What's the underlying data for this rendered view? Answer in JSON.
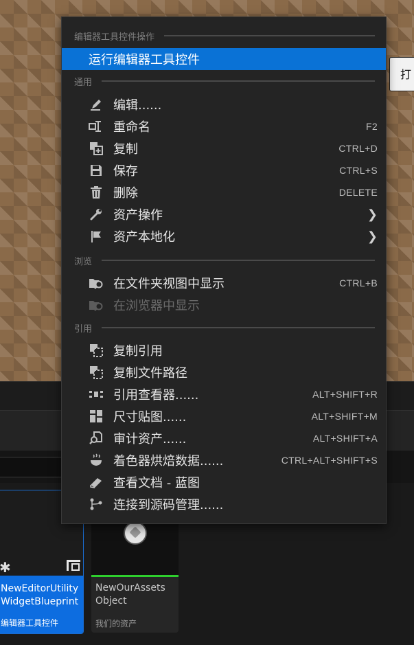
{
  "viewport": {
    "tooltip_text": "打"
  },
  "context_menu": {
    "sections": {
      "editor_tools": "编辑器工具控件操作",
      "common": "通用",
      "browse": "浏览",
      "reference": "引用"
    },
    "items": {
      "run": {
        "label": "运行编辑器工具控件"
      },
      "edit": {
        "label": "编辑......",
        "icon": "pencil-icon"
      },
      "rename": {
        "label": "重命名",
        "shortcut": "F2",
        "icon": "rename-icon"
      },
      "duplicate": {
        "label": "复制",
        "shortcut": "CTRL+D",
        "icon": "duplicate-icon"
      },
      "save": {
        "label": "保存",
        "shortcut": "CTRL+S",
        "icon": "save-icon"
      },
      "delete": {
        "label": "删除",
        "shortcut": "DELETE",
        "icon": "trash-icon"
      },
      "asset_actions": {
        "label": "资产操作",
        "icon": "wrench-icon"
      },
      "localization": {
        "label": "资产本地化",
        "icon": "flag-icon"
      },
      "show_in_folder": {
        "label": "在文件夹视图中显示",
        "shortcut": "CTRL+B",
        "icon": "folder-search-icon"
      },
      "show_in_browser": {
        "label": "在浏览器中显示",
        "icon": "folder-search-icon"
      },
      "copy_reference": {
        "label": "复制引用",
        "icon": "copy-reference-icon"
      },
      "copy_file_path": {
        "label": "复制文件路径",
        "icon": "copy-path-icon"
      },
      "reference_viewer": {
        "label": "引用查看器......",
        "shortcut": "ALT+SHIFT+R",
        "icon": "reference-viewer-icon"
      },
      "size_map": {
        "label": "尺寸贴图......",
        "shortcut": "ALT+SHIFT+M",
        "icon": "size-map-icon"
      },
      "audit_assets": {
        "label": "审计资产......",
        "shortcut": "ALT+SHIFT+A",
        "icon": "audit-icon"
      },
      "shader_cook": {
        "label": "着色器烘焙数据......",
        "shortcut": "CTRL+ALT+SHIFT+S",
        "icon": "shader-cook-icon"
      },
      "view_docs": {
        "label": "查看文档 - 蓝图",
        "icon": "docs-icon"
      },
      "source_control": {
        "label": "连接到源码管理......",
        "icon": "source-control-icon"
      }
    }
  },
  "content_browser": {
    "tiles": [
      {
        "name": "NewEditorUtility WidgetBlueprint",
        "type": "编辑器工具控件"
      },
      {
        "name": "NewOurAssets Object",
        "type": "我们的资产"
      }
    ]
  },
  "colors": {
    "highlight": "#0a72d6",
    "selected_tile": "#0d6de0",
    "asset_bar": "#2ed02e"
  }
}
